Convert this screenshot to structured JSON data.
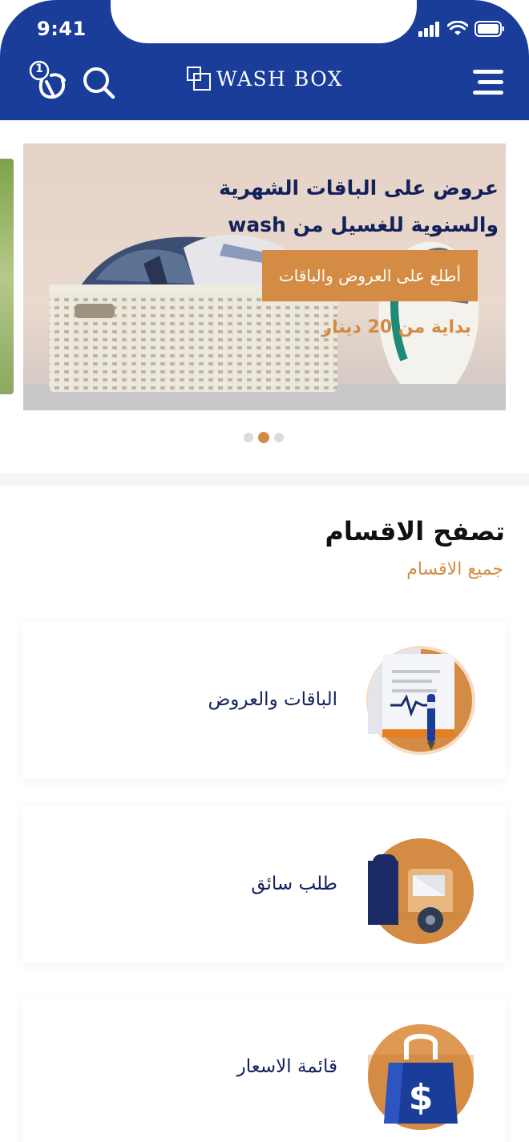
{
  "status_bar": {
    "time": "9:41"
  },
  "header": {
    "app_name": "WASH BOX",
    "cart_count": "1",
    "colors": {
      "primary": "#1a3d9a",
      "accent": "#d48b43"
    },
    "icons": [
      "cart-icon",
      "search-icon",
      "menu-icon"
    ]
  },
  "banner": {
    "title": "عروض على الباقات الشهرية والسنوية للغسيل من wash",
    "cta_label": "أطلع على العروض والباقات",
    "price_text": "بداية من 20 دينار",
    "pagination": {
      "count": 3,
      "active_index": 1
    }
  },
  "categories": {
    "title": "تصفح الاقسام",
    "link_label": "جميع الاقسام",
    "items": [
      {
        "label": "الباقات والعروض",
        "icon": "document-pen-icon"
      },
      {
        "label": "طلب سائق",
        "icon": "delivery-truck-icon"
      },
      {
        "label": "قائمة الاسعار",
        "icon": "price-bag-icon"
      }
    ]
  }
}
